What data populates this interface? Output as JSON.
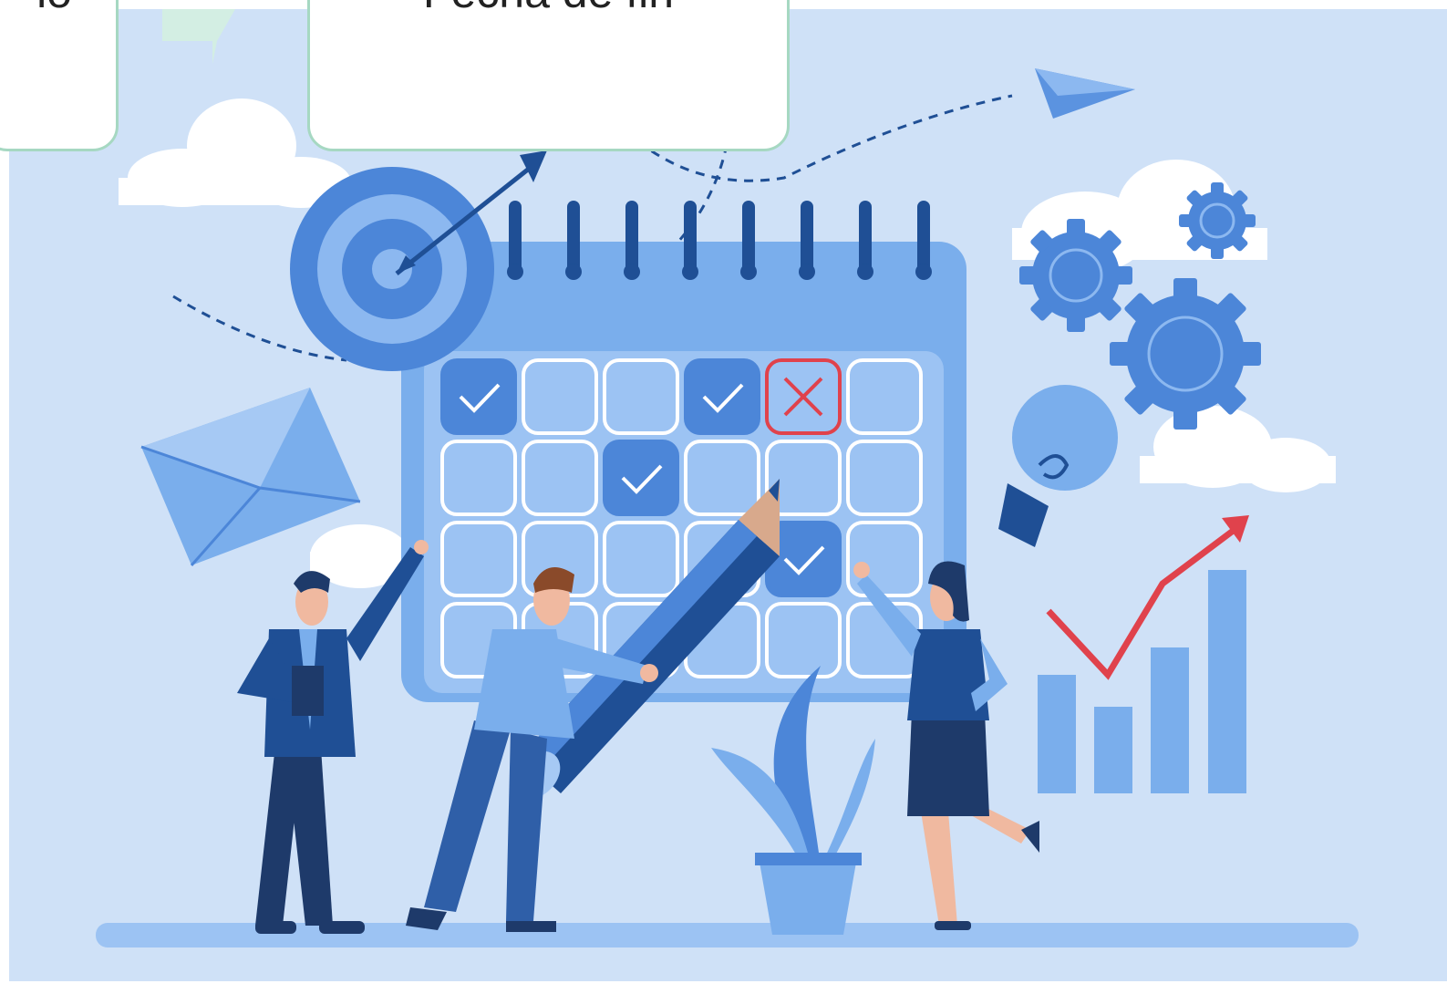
{
  "cards": {
    "left_text": "io",
    "right_text": "Fecha de fin"
  },
  "calendar": {
    "rows": 4,
    "cols": 6,
    "checked_cells": [
      [
        0,
        0
      ],
      [
        0,
        3
      ],
      [
        1,
        2
      ],
      [
        2,
        4
      ]
    ],
    "crossed_cells": [
      [
        0,
        4
      ]
    ]
  },
  "icons": [
    "target-icon",
    "arrow-icon",
    "envelope-icon",
    "paper-plane-icon",
    "gear-icon",
    "lightbulb-icon",
    "pencil-icon",
    "plant-icon",
    "growth-chart-icon"
  ],
  "colors": {
    "background": "#cfe1f7",
    "calendar": "#7aaeec",
    "accent_dark": "#1f4f95",
    "check": "#4c86d8",
    "cross": "#e0424c",
    "card_border": "#a6d8c2"
  }
}
